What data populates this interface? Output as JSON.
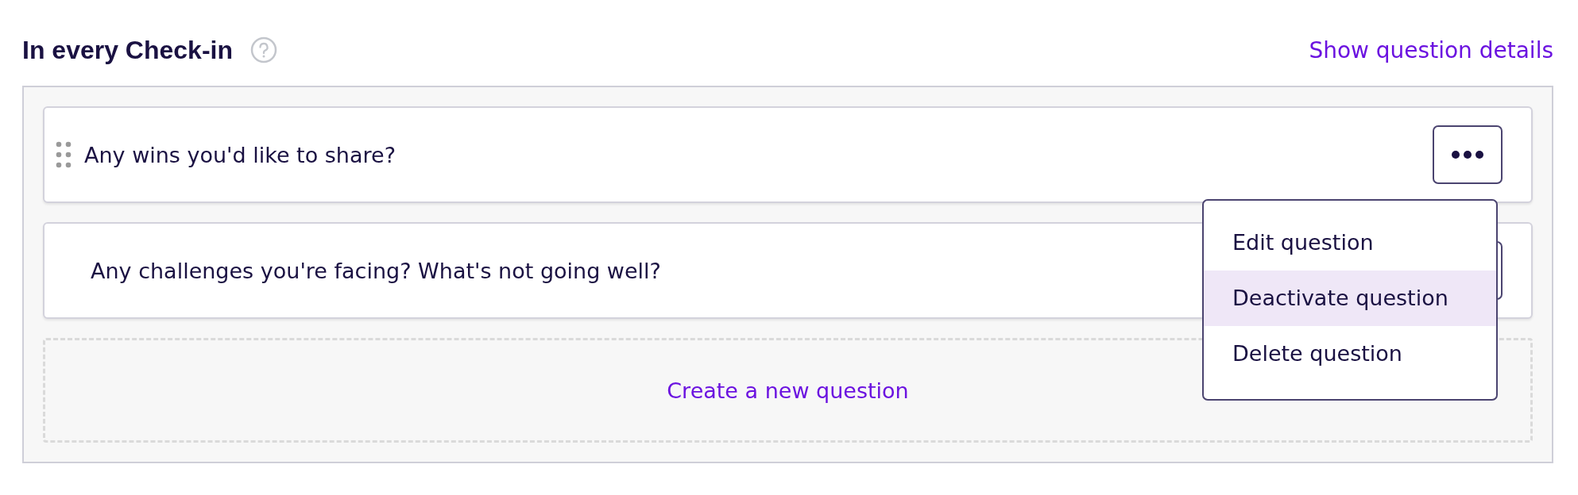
{
  "section": {
    "title": "In every Check-in",
    "details_link": "Show question details"
  },
  "questions": [
    {
      "text": "Any wins you'd like to share?",
      "drag_handle": true,
      "menu_open": true
    },
    {
      "text": "Any challenges you're facing? What's not going well?",
      "drag_handle": false,
      "menu_open": false
    }
  ],
  "menu": {
    "items": [
      {
        "label": "Edit question",
        "selected": false
      },
      {
        "label": "Deactivate question",
        "selected": true
      },
      {
        "label": "Delete question",
        "selected": false
      }
    ]
  },
  "create_link": "Create a new question"
}
